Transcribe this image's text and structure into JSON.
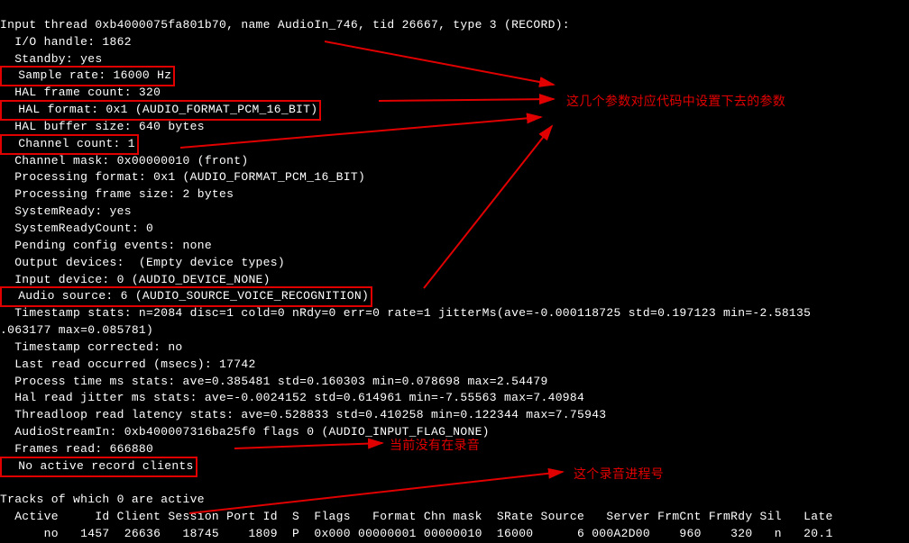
{
  "lines": {
    "l0": "Input thread 0xb4000075fa801b70, name AudioIn_746, tid 26667, type 3 (RECORD):",
    "l1": "  I/O handle: 1862",
    "l2": "  Standby: yes",
    "l3": "  Sample rate: 16000 Hz",
    "l4": "  HAL frame count: 320",
    "l5": "  HAL format: 0x1 (AUDIO_FORMAT_PCM_16_BIT)",
    "l6": "  HAL buffer size: 640 bytes",
    "l7": "  Channel count: 1",
    "l8": "  Channel mask: 0x00000010 (front)",
    "l9": "  Processing format: 0x1 (AUDIO_FORMAT_PCM_16_BIT)",
    "l10": "  Processing frame size: 2 bytes",
    "l11": "  SystemReady: yes",
    "l12": "  SystemReadyCount: 0",
    "l13": "  Pending config events: none",
    "l14": "  Output devices:  (Empty device types)",
    "l15": "  Input device: 0 (AUDIO_DEVICE_NONE)",
    "l16": "  Audio source: 6 (AUDIO_SOURCE_VOICE_RECOGNITION)",
    "l17": "  Timestamp stats: n=2084 disc=1 cold=0 nRdy=0 err=0 rate=1 jitterMs(ave=-0.000118725 std=0.197123 min=-2.58135",
    "l18": ".063177 max=0.085781)",
    "l19": "  Timestamp corrected: no",
    "l20": "  Last read occurred (msecs): 17742",
    "l21": "  Process time ms stats: ave=0.385481 std=0.160303 min=0.078698 max=2.54479",
    "l22": "  Hal read jitter ms stats: ave=-0.0024152 std=0.614961 min=-7.55563 max=7.40984",
    "l23": "  Threadloop read latency stats: ave=0.528833 std=0.410258 min=0.122344 max=7.75943",
    "l24": "  AudioStreamIn: 0xb400007316ba25f0 flags 0 (AUDIO_INPUT_FLAG_NONE)",
    "l25": "  Frames read: 666880",
    "l26": "  No active record clients",
    "l27": "  ",
    "l28": "Tracks of which 0 are active",
    "l29_header": "  Active     Id Client Session Port Id  S  Flags   Format Chn mask  SRate Source   Server FrmCnt FrmRdy Sil   Late",
    "l30_row": "      no   1457  26636   18745    1809  P  0x000 00000001 00000010  16000      6 000A2D00    960    320   n   20.1"
  },
  "annotations": {
    "a1": "这几个参数对应代码中设置下去的参数",
    "a2": "当前没有在录音",
    "a3": "这个录音进程号"
  },
  "table": {
    "headers": [
      "Active",
      "Id",
      "Client",
      "Session",
      "Port Id",
      "S",
      "Flags",
      "Format",
      "Chn mask",
      "SRate",
      "Source",
      "Server",
      "FrmCnt",
      "FrmRdy",
      "Sil",
      "Late"
    ],
    "row": [
      "no",
      "1457",
      "26636",
      "18745",
      "1809",
      "P",
      "0x000",
      "00000001",
      "00000010",
      "16000",
      "6",
      "000A2D00",
      "960",
      "320",
      "n",
      "20.1"
    ]
  }
}
